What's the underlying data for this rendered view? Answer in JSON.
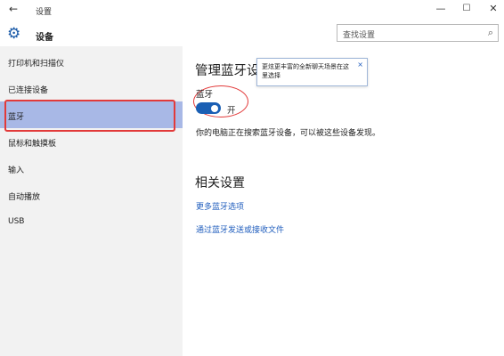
{
  "titlebar": {
    "back_icon": "←",
    "title": "设置",
    "minimize": "—",
    "maximize": "☐",
    "close": "✕"
  },
  "header": {
    "gear_icon": "⚙",
    "title": "设备",
    "search_placeholder": "查找设置",
    "search_icon": "⌕"
  },
  "sidebar": {
    "items": [
      {
        "label": "打印机和扫描仪"
      },
      {
        "label": "已连接设备"
      },
      {
        "label": "蓝牙"
      },
      {
        "label": "鼠标和触摸板"
      },
      {
        "label": "输入"
      },
      {
        "label": "自动播放"
      },
      {
        "label": "USB"
      }
    ],
    "active_index": 2
  },
  "main": {
    "title": "管理蓝牙设",
    "bluetooth_label": "蓝牙",
    "toggle_state": "开",
    "toggle_on": true,
    "description": "你的电脑正在搜索蓝牙设备，可以被这些设备发现。",
    "related_title": "相关设置",
    "links": [
      {
        "label": "更多蓝牙选项"
      },
      {
        "label": "通过蓝牙发送或接收文件"
      }
    ]
  },
  "tooltip": {
    "text": "更炫更丰富的全新聊天场景在这里选择",
    "close": "×"
  },
  "colors": {
    "accent": "#1a5fb4",
    "active_bg": "#a8b8e6",
    "sidebar_bg": "#f2f2f2",
    "link": "#1f5dbd",
    "annotation_red": "#e23a3a"
  }
}
